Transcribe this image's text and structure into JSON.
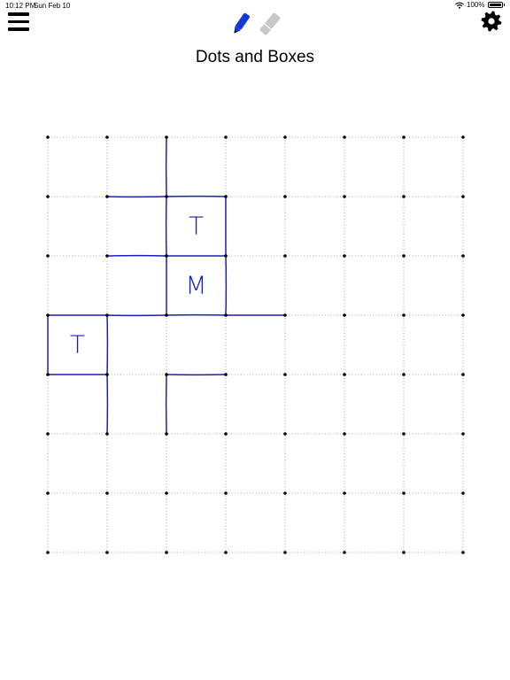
{
  "status_bar": {
    "time": "10:12 PM",
    "date": "Sun Feb 10",
    "battery": "100%",
    "battery_level": 1.0
  },
  "toolbar": {
    "menu_icon": "hamburger-menu-icon",
    "pen_icon": "blue-pen-icon",
    "eraser_icon": "gray-eraser-icon",
    "settings_icon": "gear-icon"
  },
  "title": "Dots and Boxes",
  "colors": {
    "ink": "#1a1fb8",
    "pen": "#1338d6",
    "eraser": "#c8c8c8",
    "grid_dots": "#000000",
    "guide_lines": "#9a9a9a"
  },
  "board": {
    "dot_rows": 8,
    "dot_cols": 8,
    "drawn_lines": [
      {
        "from": [
          0,
          2
        ],
        "to": [
          1,
          2
        ]
      },
      {
        "from": [
          1,
          1
        ],
        "to": [
          1,
          2
        ]
      },
      {
        "from": [
          1,
          2
        ],
        "to": [
          1,
          3
        ]
      },
      {
        "from": [
          1,
          2
        ],
        "to": [
          2,
          2
        ]
      },
      {
        "from": [
          1,
          3
        ],
        "to": [
          2,
          3
        ]
      },
      {
        "from": [
          2,
          1
        ],
        "to": [
          2,
          2
        ]
      },
      {
        "from": [
          2,
          2
        ],
        "to": [
          2,
          3
        ]
      },
      {
        "from": [
          2,
          2
        ],
        "to": [
          3,
          2
        ]
      },
      {
        "from": [
          2,
          3
        ],
        "to": [
          3,
          3
        ]
      },
      {
        "from": [
          3,
          0
        ],
        "to": [
          3,
          1
        ]
      },
      {
        "from": [
          3,
          1
        ],
        "to": [
          3,
          2
        ]
      },
      {
        "from": [
          3,
          2
        ],
        "to": [
          3,
          3
        ]
      },
      {
        "from": [
          3,
          3
        ],
        "to": [
          3,
          4
        ]
      },
      {
        "from": [
          3,
          0
        ],
        "to": [
          4,
          0
        ]
      },
      {
        "from": [
          3,
          1
        ],
        "to": [
          4,
          1
        ]
      },
      {
        "from": [
          4,
          0
        ],
        "to": [
          4,
          1
        ]
      },
      {
        "from": [
          4,
          2
        ],
        "to": [
          4,
          3
        ]
      },
      {
        "from": [
          4,
          1
        ],
        "to": [
          5,
          1
        ]
      },
      {
        "from": [
          4,
          2
        ],
        "to": [
          5,
          2
        ]
      }
    ],
    "boxes": [
      {
        "row": 1,
        "col": 2,
        "letter": "T"
      },
      {
        "row": 2,
        "col": 2,
        "letter": "M"
      },
      {
        "row": 3,
        "col": 0,
        "letter": "T"
      }
    ]
  }
}
